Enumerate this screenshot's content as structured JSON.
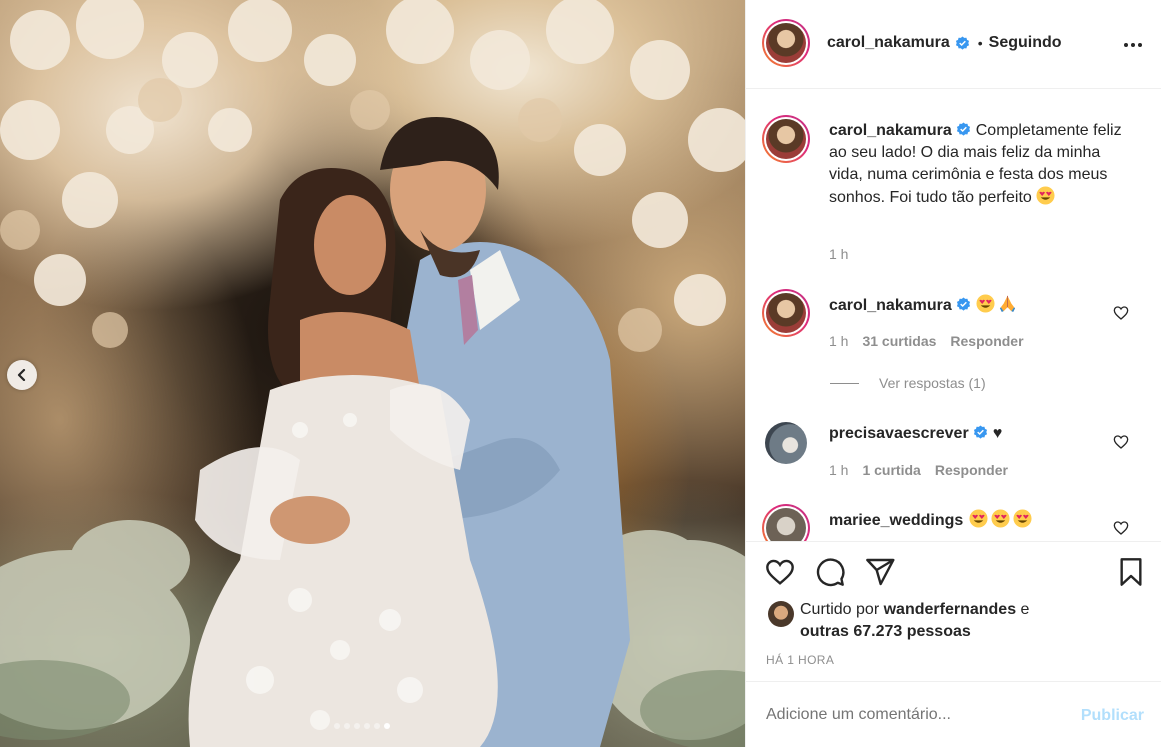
{
  "post": {
    "carousel": {
      "total": 6,
      "active_index": 5
    },
    "header": {
      "username": "carol_nakamura",
      "verified": true,
      "separator": "•",
      "follow_label": "Seguindo"
    },
    "caption": {
      "username": "carol_nakamura",
      "text": "Completamente feliz ao seu lado! O dia mais feliz da minha vida, numa cerimônia e festa dos meus sonhos. Foi tudo tão perfeito",
      "emoji": "heart-eyes",
      "time": "1 h"
    },
    "comments": [
      {
        "username": "carol_nakamura",
        "verified": true,
        "text": "",
        "emojis": [
          "heart-eyes",
          "folded-hands"
        ],
        "time": "1 h",
        "likes": "31 curtidas",
        "reply_label": "Responder",
        "view_replies": "Ver respostas (1)"
      },
      {
        "username": "precisavaescrever",
        "verified": true,
        "text": "♥",
        "time": "1 h",
        "likes": "1 curtida",
        "reply_label": "Responder"
      },
      {
        "username": "mariee_weddings",
        "verified": false,
        "emojis": [
          "heart-eyes",
          "heart-eyes",
          "heart-eyes"
        ]
      }
    ],
    "likes": {
      "prefix": "Curtido por",
      "user": "wanderfernandes",
      "connector": "e",
      "others": "outras 67.273 pessoas"
    },
    "timestamp": "HÁ 1 HORA",
    "add_comment": {
      "placeholder": "Adicione um comentário...",
      "publish_label": "Publicar"
    },
    "colors": {
      "verified": "#3897f0",
      "publish_disabled": "#b2dffc",
      "muted": "#8e8e8e",
      "text": "#262626"
    }
  }
}
